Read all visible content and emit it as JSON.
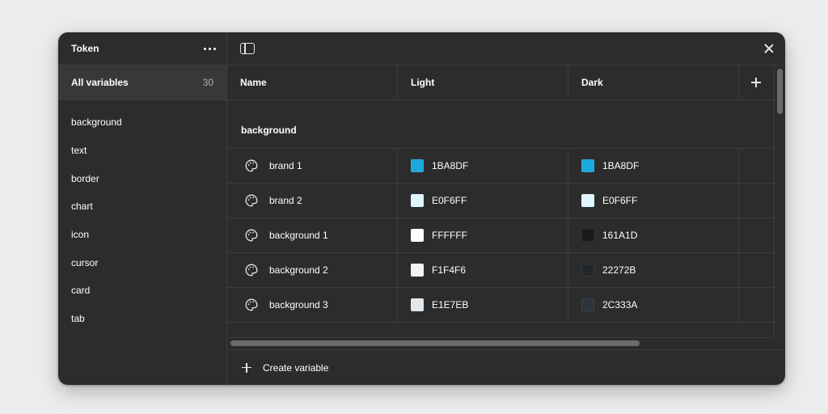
{
  "sidebar": {
    "title": "Token",
    "all": {
      "label": "All variables",
      "count": "30"
    },
    "items": [
      {
        "label": "background"
      },
      {
        "label": "text"
      },
      {
        "label": "border"
      },
      {
        "label": "chart"
      },
      {
        "label": "icon"
      },
      {
        "label": "cursor"
      },
      {
        "label": "card"
      },
      {
        "label": "tab"
      }
    ]
  },
  "table": {
    "columns": {
      "name": "Name",
      "light": "Light",
      "dark": "Dark"
    },
    "group": "background",
    "rows": [
      {
        "name": "brand 1",
        "light": "1BA8DF",
        "dark": "1BA8DF",
        "light_color": "#1BA8DF",
        "dark_color": "#1BA8DF"
      },
      {
        "name": "brand 2",
        "light": "E0F6FF",
        "dark": "E0F6FF",
        "light_color": "#E0F6FF",
        "dark_color": "#E0F6FF"
      },
      {
        "name": "background 1",
        "light": "FFFFFF",
        "dark": "161A1D",
        "light_color": "#FFFFFF",
        "dark_color": "#161A1D"
      },
      {
        "name": "background 2",
        "light": "F1F4F6",
        "dark": "22272B",
        "light_color": "#F1F4F6",
        "dark_color": "#22272B"
      },
      {
        "name": "background 3",
        "light": "E1E7EB",
        "dark": "2C333A",
        "light_color": "#E1E7EB",
        "dark_color": "#2C333A"
      }
    ]
  },
  "footer": {
    "create_label": "Create variable"
  },
  "icons": {
    "more": "more-horizontal-icon",
    "sidebar_toggle": "sidebar-toggle-icon",
    "close": "close-icon",
    "add_column": "plus-icon",
    "variable": "palette-icon"
  }
}
